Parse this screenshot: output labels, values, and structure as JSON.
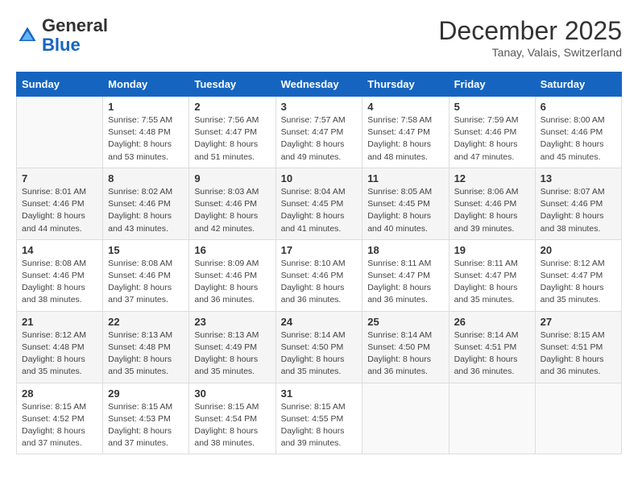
{
  "header": {
    "logo": {
      "general": "General",
      "blue": "Blue"
    },
    "title": "December 2025",
    "location": "Tanay, Valais, Switzerland"
  },
  "days_header": [
    "Sunday",
    "Monday",
    "Tuesday",
    "Wednesday",
    "Thursday",
    "Friday",
    "Saturday"
  ],
  "weeks": [
    [
      {
        "day": "",
        "detail": ""
      },
      {
        "day": "1",
        "detail": "Sunrise: 7:55 AM\nSunset: 4:48 PM\nDaylight: 8 hours\nand 53 minutes."
      },
      {
        "day": "2",
        "detail": "Sunrise: 7:56 AM\nSunset: 4:47 PM\nDaylight: 8 hours\nand 51 minutes."
      },
      {
        "day": "3",
        "detail": "Sunrise: 7:57 AM\nSunset: 4:47 PM\nDaylight: 8 hours\nand 49 minutes."
      },
      {
        "day": "4",
        "detail": "Sunrise: 7:58 AM\nSunset: 4:47 PM\nDaylight: 8 hours\nand 48 minutes."
      },
      {
        "day": "5",
        "detail": "Sunrise: 7:59 AM\nSunset: 4:46 PM\nDaylight: 8 hours\nand 47 minutes."
      },
      {
        "day": "6",
        "detail": "Sunrise: 8:00 AM\nSunset: 4:46 PM\nDaylight: 8 hours\nand 45 minutes."
      }
    ],
    [
      {
        "day": "7",
        "detail": "Sunrise: 8:01 AM\nSunset: 4:46 PM\nDaylight: 8 hours\nand 44 minutes."
      },
      {
        "day": "8",
        "detail": "Sunrise: 8:02 AM\nSunset: 4:46 PM\nDaylight: 8 hours\nand 43 minutes."
      },
      {
        "day": "9",
        "detail": "Sunrise: 8:03 AM\nSunset: 4:46 PM\nDaylight: 8 hours\nand 42 minutes."
      },
      {
        "day": "10",
        "detail": "Sunrise: 8:04 AM\nSunset: 4:45 PM\nDaylight: 8 hours\nand 41 minutes."
      },
      {
        "day": "11",
        "detail": "Sunrise: 8:05 AM\nSunset: 4:45 PM\nDaylight: 8 hours\nand 40 minutes."
      },
      {
        "day": "12",
        "detail": "Sunrise: 8:06 AM\nSunset: 4:46 PM\nDaylight: 8 hours\nand 39 minutes."
      },
      {
        "day": "13",
        "detail": "Sunrise: 8:07 AM\nSunset: 4:46 PM\nDaylight: 8 hours\nand 38 minutes."
      }
    ],
    [
      {
        "day": "14",
        "detail": "Sunrise: 8:08 AM\nSunset: 4:46 PM\nDaylight: 8 hours\nand 38 minutes."
      },
      {
        "day": "15",
        "detail": "Sunrise: 8:08 AM\nSunset: 4:46 PM\nDaylight: 8 hours\nand 37 minutes."
      },
      {
        "day": "16",
        "detail": "Sunrise: 8:09 AM\nSunset: 4:46 PM\nDaylight: 8 hours\nand 36 minutes."
      },
      {
        "day": "17",
        "detail": "Sunrise: 8:10 AM\nSunset: 4:46 PM\nDaylight: 8 hours\nand 36 minutes."
      },
      {
        "day": "18",
        "detail": "Sunrise: 8:11 AM\nSunset: 4:47 PM\nDaylight: 8 hours\nand 36 minutes."
      },
      {
        "day": "19",
        "detail": "Sunrise: 8:11 AM\nSunset: 4:47 PM\nDaylight: 8 hours\nand 35 minutes."
      },
      {
        "day": "20",
        "detail": "Sunrise: 8:12 AM\nSunset: 4:47 PM\nDaylight: 8 hours\nand 35 minutes."
      }
    ],
    [
      {
        "day": "21",
        "detail": "Sunrise: 8:12 AM\nSunset: 4:48 PM\nDaylight: 8 hours\nand 35 minutes."
      },
      {
        "day": "22",
        "detail": "Sunrise: 8:13 AM\nSunset: 4:48 PM\nDaylight: 8 hours\nand 35 minutes."
      },
      {
        "day": "23",
        "detail": "Sunrise: 8:13 AM\nSunset: 4:49 PM\nDaylight: 8 hours\nand 35 minutes."
      },
      {
        "day": "24",
        "detail": "Sunrise: 8:14 AM\nSunset: 4:50 PM\nDaylight: 8 hours\nand 35 minutes."
      },
      {
        "day": "25",
        "detail": "Sunrise: 8:14 AM\nSunset: 4:50 PM\nDaylight: 8 hours\nand 36 minutes."
      },
      {
        "day": "26",
        "detail": "Sunrise: 8:14 AM\nSunset: 4:51 PM\nDaylight: 8 hours\nand 36 minutes."
      },
      {
        "day": "27",
        "detail": "Sunrise: 8:15 AM\nSunset: 4:51 PM\nDaylight: 8 hours\nand 36 minutes."
      }
    ],
    [
      {
        "day": "28",
        "detail": "Sunrise: 8:15 AM\nSunset: 4:52 PM\nDaylight: 8 hours\nand 37 minutes."
      },
      {
        "day": "29",
        "detail": "Sunrise: 8:15 AM\nSunset: 4:53 PM\nDaylight: 8 hours\nand 37 minutes."
      },
      {
        "day": "30",
        "detail": "Sunrise: 8:15 AM\nSunset: 4:54 PM\nDaylight: 8 hours\nand 38 minutes."
      },
      {
        "day": "31",
        "detail": "Sunrise: 8:15 AM\nSunset: 4:55 PM\nDaylight: 8 hours\nand 39 minutes."
      },
      {
        "day": "",
        "detail": ""
      },
      {
        "day": "",
        "detail": ""
      },
      {
        "day": "",
        "detail": ""
      }
    ]
  ]
}
